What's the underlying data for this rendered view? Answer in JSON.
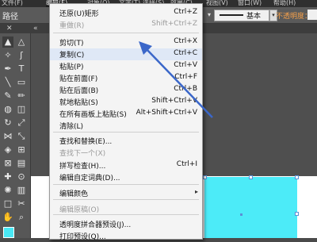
{
  "menubar": {
    "items": [
      "文件(F)",
      "编辑(E)",
      "对象(O)",
      "文字(T)",
      "选择(S)",
      "效果(C)",
      "视图(V)",
      "窗口(W)",
      "帮助(H)"
    ]
  },
  "controlbar": {
    "path_label": "路径",
    "stroke_style": "基本",
    "opacity_label": "不透明度："
  },
  "tabbar": {
    "close": "✕"
  },
  "edit_menu": {
    "items": [
      {
        "label": "还原(U)矩形",
        "shortcut": "Ctrl+Z",
        "disabled": false
      },
      {
        "label": "重做(R)",
        "shortcut": "Shift+Ctrl+Z",
        "disabled": true
      },
      {
        "label": "剪切(T)",
        "shortcut": "Ctrl+X",
        "disabled": false
      },
      {
        "label": "复制(C)",
        "shortcut": "Ctrl+C",
        "disabled": false,
        "highlighted": true
      },
      {
        "label": "粘贴(P)",
        "shortcut": "Ctrl+V",
        "disabled": false
      },
      {
        "label": "贴在前面(F)",
        "shortcut": "Ctrl+F",
        "disabled": false
      },
      {
        "label": "贴在后面(B)",
        "shortcut": "Ctrl+B",
        "disabled": false
      },
      {
        "label": "就地粘贴(S)",
        "shortcut": "Shift+Ctrl+V",
        "disabled": false
      },
      {
        "label": "在所有画板上粘贴(S)",
        "shortcut": "Alt+Shift+Ctrl+V",
        "disabled": false
      },
      {
        "label": "清除(L)",
        "shortcut": "",
        "disabled": false
      },
      {
        "label": "查找和替换(E)...",
        "shortcut": "",
        "disabled": false
      },
      {
        "label": "查找下一个(X)",
        "shortcut": "",
        "disabled": true
      },
      {
        "label": "拼写检查(H)...",
        "shortcut": "Ctrl+I",
        "disabled": false
      },
      {
        "label": "编辑自定词典(D)...",
        "shortcut": "",
        "disabled": false
      },
      {
        "label": "编辑颜色",
        "shortcut": "",
        "disabled": false,
        "submenu": true
      },
      {
        "label": "编辑原稿(O)",
        "shortcut": "",
        "disabled": true
      },
      {
        "label": "透明度拼合器预设(J)...",
        "shortcut": "",
        "disabled": false
      },
      {
        "label": "打印预设(Q)...",
        "shortcut": "",
        "disabled": false
      }
    ]
  },
  "colors": {
    "selection_fill": "#4cebf8",
    "annotation_arrow": "#3b67c9",
    "menu_hover": "#dfe8f6"
  },
  "tools": [
    "selection-tool",
    "direct-selection-tool",
    "magic-wand-tool",
    "lasso-tool",
    "pen-tool",
    "type-tool",
    "line-tool",
    "rectangle-tool",
    "paintbrush-tool",
    "pencil-tool",
    "blob-brush-tool",
    "eraser-tool",
    "rotate-tool",
    "scale-tool",
    "width-tool",
    "free-transform-tool",
    "shape-builder-tool",
    "perspective-grid-tool",
    "mesh-tool",
    "gradient-tool",
    "eyedropper-tool",
    "blend-tool",
    "symbol-sprayer-tool",
    "column-graph-tool",
    "artboard-tool",
    "slice-tool",
    "hand-tool",
    "zoom-tool"
  ]
}
